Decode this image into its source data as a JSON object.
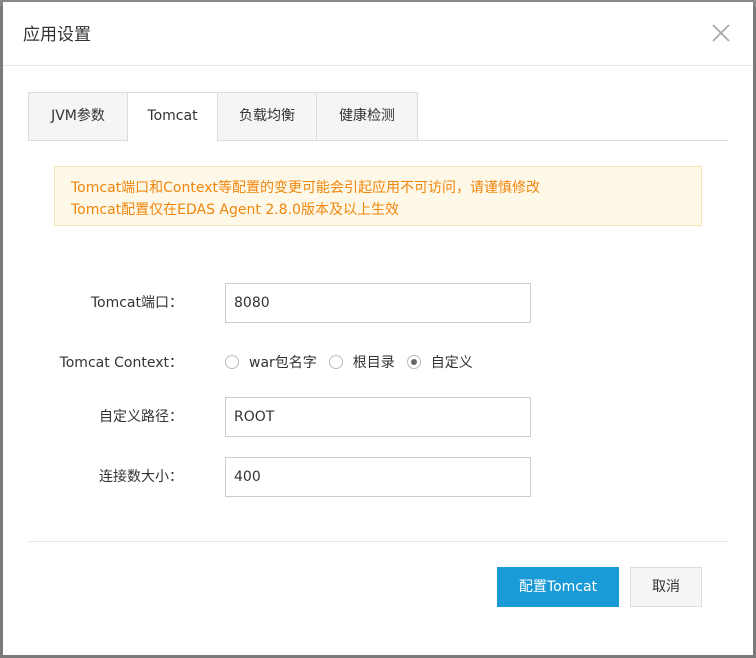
{
  "dialog": {
    "title": "应用设置"
  },
  "tabs": [
    {
      "label": "JVM参数",
      "active": false
    },
    {
      "label": "Tomcat",
      "active": true
    },
    {
      "label": "负载均衡",
      "active": false
    },
    {
      "label": "健康检测",
      "active": false
    }
  ],
  "alert": {
    "line1": "Tomcat端口和Context等配置的变更可能会引起应用不可访问，请谨慎修改",
    "line2": "Tomcat配置仅在EDAS Agent 2.8.0版本及以上生效",
    "color": "#f0860c"
  },
  "form": {
    "port": {
      "label": "Tomcat端口：",
      "value": "8080"
    },
    "context": {
      "label": "Tomcat Context：",
      "options": [
        {
          "label": "war包名字",
          "checked": false
        },
        {
          "label": "根目录",
          "checked": false
        },
        {
          "label": "自定义",
          "checked": true
        }
      ]
    },
    "custom_path": {
      "label": "自定义路径：",
      "value": "ROOT"
    },
    "max_connections": {
      "label": "连接数大小：",
      "value": "400"
    }
  },
  "footer": {
    "confirm_label": "配置Tomcat",
    "cancel_label": "取消",
    "primary_color": "#1a9ad6"
  },
  "icons": {
    "close": "close-icon"
  }
}
